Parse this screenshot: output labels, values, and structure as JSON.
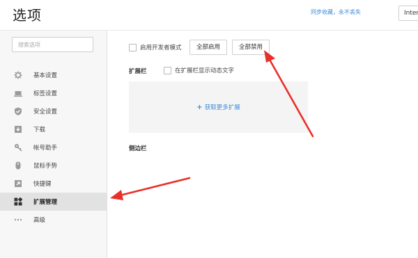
{
  "header": {
    "title": "选项",
    "sync_text": "同步收藏，永不丢失",
    "lang_text": "Inter"
  },
  "sidebar": {
    "search_placeholder": "搜索选项",
    "items": [
      {
        "label": "基本设置",
        "icon": "gear-icon",
        "active": false
      },
      {
        "label": "标签设置",
        "icon": "laptop-icon",
        "active": false
      },
      {
        "label": "安全设置",
        "icon": "shield-icon",
        "active": false
      },
      {
        "label": "下载",
        "icon": "download-icon",
        "active": false
      },
      {
        "label": "帐号助手",
        "icon": "key-icon",
        "active": false
      },
      {
        "label": "鼠标手势",
        "icon": "mouse-icon",
        "active": false
      },
      {
        "label": "快捷键",
        "icon": "shortcut-icon",
        "active": false
      },
      {
        "label": "扩展管理",
        "icon": "grid-icon",
        "active": true
      },
      {
        "label": "高级",
        "icon": "more-icon",
        "active": false
      }
    ]
  },
  "main": {
    "dev_mode_label": "启用开发者模式",
    "enable_all_label": "全部启用",
    "disable_all_label": "全部禁用",
    "ext_bar_title": "扩展栏",
    "ext_bar_option": "在扩展栏显示动态文字",
    "get_more_label": "获取更多扩展",
    "side_bar_title": "侧边栏"
  },
  "colors": {
    "accent": "#3b8bd6",
    "annotation_arrow": "#e8302a",
    "active_item_bg": "#e2e2e2"
  }
}
